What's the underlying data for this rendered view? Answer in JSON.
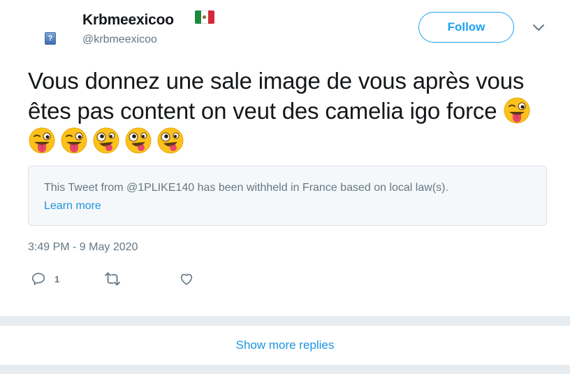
{
  "tweet": {
    "author": {
      "display_name": "Krbmeexicoo",
      "handle": "@krbmeexicoo",
      "flag_icon": "flag-mexico-icon"
    },
    "follow_label": "Follow",
    "text": "Vous donnez une sale image de vous après vous êtes pas content on veut des camelia igo force",
    "emojis": [
      "face-with-tongue-wink",
      "face-with-tongue-wink",
      "face-with-tongue-wink",
      "zany-face",
      "zany-face",
      "zany-face"
    ],
    "withheld": {
      "message": "This Tweet from @1PLIKE140 has been withheld in France based on local law(s).",
      "link": "Learn more"
    },
    "timestamp": "3:49 PM - 9 May 2020",
    "actions": {
      "reply_count": "1"
    }
  },
  "show_more_label": "Show more replies",
  "colors": {
    "accent": "#1da1f2",
    "link": "#1b95e0",
    "muted": "#657786",
    "separator": "#e6ecf0"
  }
}
